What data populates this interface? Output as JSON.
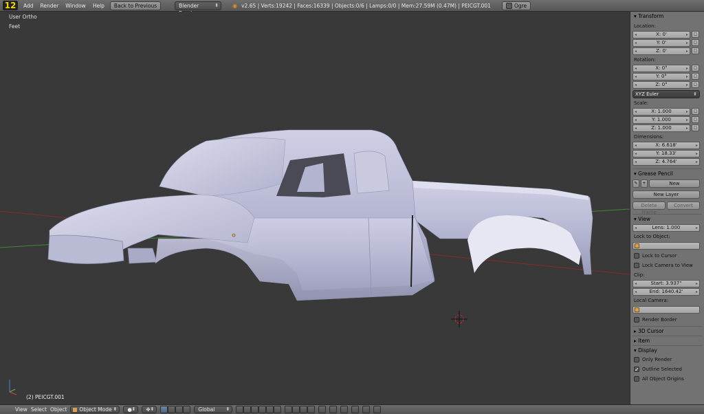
{
  "topbar": {
    "logo_text": "12",
    "menus": [
      "Add",
      "Render",
      "Window",
      "Help"
    ],
    "back_button": "Back to Previous",
    "render_engine": "Blender Render",
    "stats": "v2.65 | Verts:19242 | Faces:16339 | Objects:0/6 | Lamps:0/0 | Mem:27.59M (0.47M) | PEICGT.001",
    "ogre_label": "Ogre"
  },
  "viewport": {
    "view_name": "User Ortho",
    "units": "Feet",
    "object_label": "(2) PEICGT.001"
  },
  "panel": {
    "transform": {
      "header": "Transform",
      "location_label": "Location:",
      "location": [
        "X: 0'",
        "Y: 0'",
        "Z: 0'"
      ],
      "rotation_label": "Rotation:",
      "rotation": [
        "X: 0°",
        "Y: 0°",
        "Z: 0°"
      ],
      "rotation_mode": "XYZ Euler",
      "scale_label": "Scale:",
      "scale": [
        "X: 1.000",
        "Y: 1.000",
        "Z: 1.000"
      ],
      "dimensions_label": "Dimensions:",
      "dimensions": [
        "X: 6.618'",
        "Y: 18.33'",
        "Z: 4.764'"
      ]
    },
    "grease_pencil": {
      "header": "Grease Pencil",
      "new": "New",
      "new_layer": "New Layer",
      "delete_frame": "Delete Frame",
      "convert": "Convert"
    },
    "view": {
      "header": "View",
      "lens": "Lens: 1.000",
      "lock_to_object_label": "Lock to Object:",
      "lock_to_cursor": "Lock to Cursor",
      "lock_camera_to_view": "Lock Camera to View",
      "clip_label": "Clip:",
      "clip_start": "Start: 3.937\"",
      "clip_end": "End: 1640.42'",
      "local_camera_label": "Local Camera:",
      "render_border": "Render Border"
    },
    "cursor_3d_header": "3D Cursor",
    "item_header": "Item",
    "display": {
      "header": "Display",
      "only_render": "Only Render",
      "outline_selected": "Outline Selected",
      "all_object_origins": "All Object Origins"
    }
  },
  "bottombar": {
    "menus": [
      "View",
      "Select",
      "Object"
    ],
    "mode": "Object Mode",
    "orientation": "Global"
  },
  "colors": {
    "viewport_bg": "#393939",
    "panel_bg": "#727272",
    "mesh": "#b8b9d4",
    "x_axis": "#8a2a2a",
    "y_axis": "#3d8a2f"
  }
}
